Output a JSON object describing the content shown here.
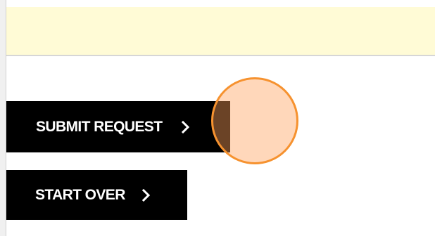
{
  "notice": {
    "text": ""
  },
  "buttons": {
    "submit_label": "SUBMIT REQUEST",
    "start_over_label": "START OVER"
  },
  "icons": {
    "submit_chevron": "chevron-right-icon",
    "start_over_chevron": "chevron-right-icon"
  },
  "colors": {
    "notice_background": "#fffbd6",
    "button_background": "#000000",
    "button_text": "#ffffff",
    "touch_indicator_border": "#f6922f",
    "touch_indicator_fill": "#ffa05a"
  }
}
